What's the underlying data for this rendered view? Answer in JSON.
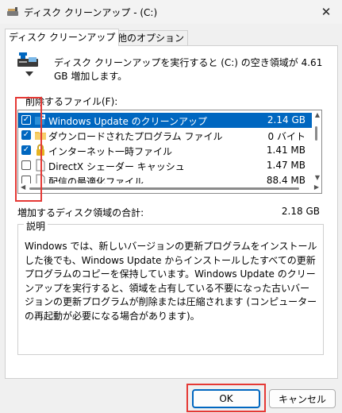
{
  "window": {
    "title": "ディスク クリーンアップ - (C:)"
  },
  "tabs": [
    {
      "label": "ディスク クリーンアップ"
    },
    {
      "label": "その他のオプション"
    }
  ],
  "summary": "ディスク クリーンアップを実行すると (C:) の空き領域が 4.61 GB 増加します。",
  "files_label": "削除するファイル(F):",
  "files": [
    {
      "name": "Windows Update のクリーンアップ",
      "size": "2.14 GB",
      "checked": true,
      "selected": true,
      "icon": "windows-update-icon"
    },
    {
      "name": "ダウンロードされたプログラム ファイル",
      "size": "0 バイト",
      "checked": true,
      "selected": false,
      "icon": "folder-icon"
    },
    {
      "name": "インターネット一時ファイル",
      "size": "1.41 MB",
      "checked": true,
      "selected": false,
      "icon": "lock-icon"
    },
    {
      "name": "DirectX シェーダー キャッシュ",
      "size": "1.47 MB",
      "checked": false,
      "selected": false,
      "icon": "document-icon"
    },
    {
      "name": "配信の最適化ファイル",
      "size": "88.4 MB",
      "checked": false,
      "selected": false,
      "icon": "document-icon"
    }
  ],
  "gain": {
    "label": "増加するディスク領域の合計:",
    "value": "2.18 GB"
  },
  "description": {
    "title": "説明",
    "text": "Windows では、新しいバージョンの更新プログラムをインストールした後でも、Windows Update からインストールしたすべての更新プログラムのコピーを保持しています。Windows Update のクリーンアップを実行すると、領域を占有している不要になった古いバージョンの更新プログラムが削除または圧縮されます (コンピューターの再起動が必要になる場合があります)。"
  },
  "buttons": {
    "ok": "OK",
    "cancel": "キャンセル"
  },
  "colors": {
    "accent": "#0067c0",
    "highlight_outline": "#e53935"
  }
}
